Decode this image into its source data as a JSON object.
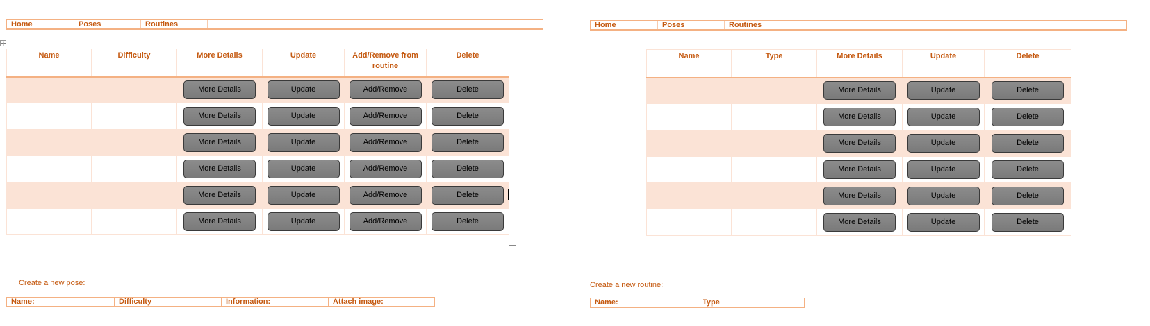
{
  "left": {
    "nav": [
      "Home",
      "Poses",
      "Routines"
    ],
    "table": {
      "headers": [
        "Name",
        "Difficulty",
        "More Details",
        "Update",
        "Add/Remove from routine",
        "Delete"
      ],
      "row_buttons": [
        "More Details",
        "Update",
        "Add/Remove",
        "Delete"
      ],
      "row_count": 6
    },
    "create_caption": "Create a new pose:",
    "form_fields": [
      "Name:",
      "Difficulty",
      "Information:",
      "Attach image:"
    ]
  },
  "right": {
    "nav": [
      "Home",
      "Poses",
      "Routines"
    ],
    "table": {
      "headers": [
        "Name",
        "Type",
        "More Details",
        "Update",
        "Delete"
      ],
      "row_buttons": [
        "More Details",
        "Update",
        "Delete"
      ],
      "row_count": 6
    },
    "create_caption": "Create a new routine:",
    "form_fields": [
      "Name:",
      "Type"
    ]
  },
  "icons": {
    "move_handle": "table-move-handle-icon",
    "resize_handle": "table-resize-handle-icon"
  }
}
